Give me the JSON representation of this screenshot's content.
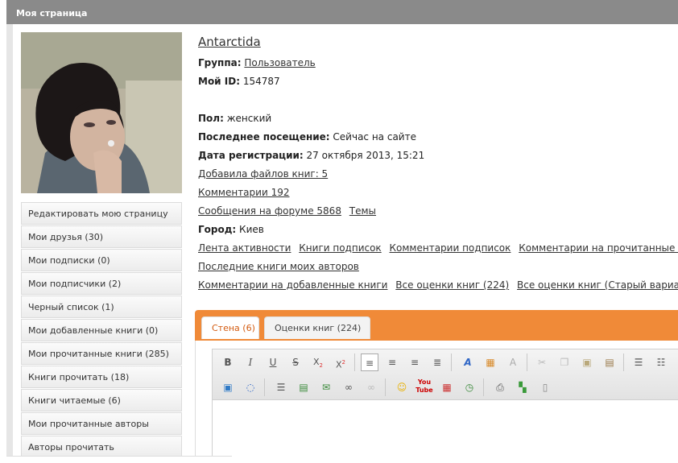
{
  "page": {
    "title": "Моя страница"
  },
  "sidebar": {
    "items": [
      {
        "label": "Редактировать мою страницу"
      },
      {
        "label": "Мои друзья (30)"
      },
      {
        "label": "Мои подписки (0)"
      },
      {
        "label": "Мои подписчики (2)"
      },
      {
        "label": "Черный список (1)"
      },
      {
        "label": "Мои добавленные книги (0)"
      },
      {
        "label": "Мои прочитанные книги (285)"
      },
      {
        "label": "Книги прочитать (18)"
      },
      {
        "label": "Книги читаемые (6)"
      },
      {
        "label": "Мои прочитанные авторы"
      },
      {
        "label": "Авторы прочитать"
      }
    ]
  },
  "profile": {
    "username": "Antarctida",
    "group_label": "Группа:",
    "group_value": "Пользователь",
    "id_label": "Мой ID:",
    "id_value": "154787",
    "gender_label": "Пол:",
    "gender_value": "женский",
    "last_visit_label": "Последнее посещение:",
    "last_visit_value": "Сейчас на сайте",
    "reg_label": "Дата регистрации:",
    "reg_value": "27 октября 2013, 15:21",
    "added_files": "Добавила файлов книг: 5",
    "comments": "Комментарии 192",
    "forum_messages": "Сообщения на форуме 5868",
    "topics": "Темы",
    "city_label": "Город:",
    "city_value": "Киев",
    "links_row1": [
      "Лента активности",
      "Книги подписок",
      "Комментарии подписок",
      "Комментарии на прочитанные книги"
    ],
    "links_row2": [
      "Последние книги моих авторов"
    ],
    "links_row3": [
      "Комментарии на добавленные книги",
      "Все оценки книг (224)",
      "Все оценки книг (Старый вариант)"
    ]
  },
  "tabs": [
    {
      "label": "Стена (6)",
      "active": true
    },
    {
      "label": "Оценки книг (224)",
      "active": false
    }
  ],
  "editor": {
    "toolbar_row1": [
      "bold-icon",
      "italic-icon",
      "underline-icon",
      "strikethrough-icon",
      "subscript-icon",
      "superscript-icon",
      "align-left-icon",
      "align-center-icon",
      "align-right-icon",
      "align-justify-icon",
      "text-color-icon",
      "bg-color-icon",
      "remove-format-icon",
      "cut-icon",
      "copy-icon",
      "paste-icon",
      "paste-text-icon",
      "bullet-list-icon",
      "numbered-list-icon"
    ],
    "toolbar_row2": [
      "image-icon",
      "quote-icon",
      "hr-icon",
      "insert-media-icon",
      "email-icon",
      "link-icon",
      "unlink-icon",
      "smiley-icon",
      "youtube-icon",
      "table-icon",
      "clock-icon",
      "print-icon",
      "blocks-icon",
      "document-icon"
    ]
  },
  "colors": {
    "accent_tab_bar": "#f08a38",
    "active_tab_text": "#d35b10",
    "title_bar": "#8a8a8a"
  }
}
